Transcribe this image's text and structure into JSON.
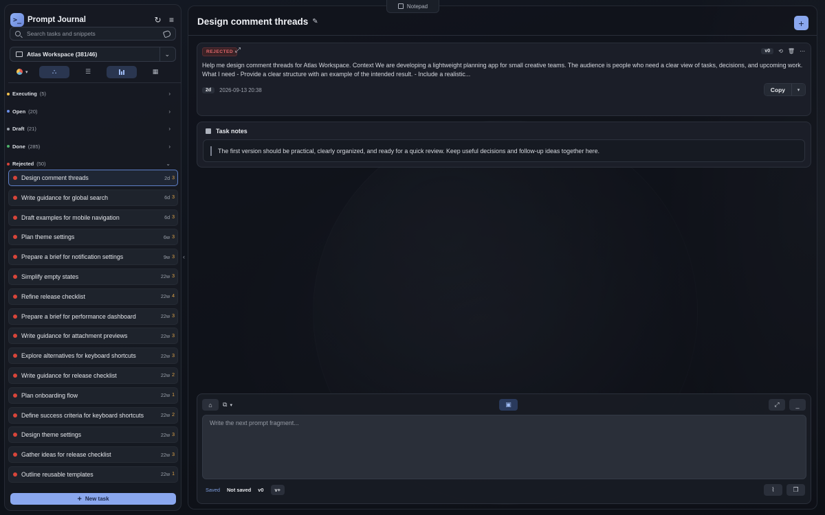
{
  "notepad": {
    "label": "Notepad"
  },
  "app": {
    "title": "Prompt Journal",
    "logo_glyph": ">_"
  },
  "search": {
    "placeholder": "Search tasks and snippets"
  },
  "workspace": {
    "label": "Atlas Workspace (381/46)"
  },
  "groups": [
    {
      "name": "Executing",
      "count": "(5)",
      "color": "#f2c14e",
      "expanded": false
    },
    {
      "name": "Open",
      "count": "(20)",
      "color": "#6b8fe8",
      "expanded": false
    },
    {
      "name": "Draft",
      "count": "(21)",
      "color": "#9aa0aa",
      "expanded": false
    },
    {
      "name": "Done",
      "count": "(285)",
      "color": "#4fb36b",
      "expanded": false
    },
    {
      "name": "Rejected",
      "count": "(50)",
      "color": "#d8453a",
      "expanded": true
    }
  ],
  "tasks": [
    {
      "title": "Design comment threads",
      "age": "2d",
      "count": "3"
    },
    {
      "title": "Write guidance for global search",
      "age": "6d",
      "count": "3"
    },
    {
      "title": "Draft examples for mobile navigation",
      "age": "6d",
      "count": "3"
    },
    {
      "title": "Plan theme settings",
      "age": "6w",
      "count": "3"
    },
    {
      "title": "Prepare a brief for notification settings",
      "age": "9w",
      "count": "3"
    },
    {
      "title": "Simplify empty states",
      "age": "22w",
      "count": "3"
    },
    {
      "title": "Refine release checklist",
      "age": "22w",
      "count": "4"
    },
    {
      "title": "Prepare a brief for performance dashboard",
      "age": "22w",
      "count": "3"
    },
    {
      "title": "Write guidance for attachment previews",
      "age": "22w",
      "count": "3"
    },
    {
      "title": "Explore alternatives for keyboard shortcuts",
      "age": "22w",
      "count": "3"
    },
    {
      "title": "Write guidance for release checklist",
      "age": "22w",
      "count": "2"
    },
    {
      "title": "Plan onboarding flow",
      "age": "22w",
      "count": "1"
    },
    {
      "title": "Define success criteria for keyboard shortcuts",
      "age": "22w",
      "count": "2"
    },
    {
      "title": "Design theme settings",
      "age": "22w",
      "count": "3"
    },
    {
      "title": "Gather ideas for release checklist",
      "age": "22w",
      "count": "3"
    },
    {
      "title": "Outline reusable templates",
      "age": "22w",
      "count": "1"
    }
  ],
  "new_task": {
    "label": "New task"
  },
  "main": {
    "title": "Design comment threads",
    "add_label": "+"
  },
  "prompt": {
    "status": "REJECTED",
    "version": "v0",
    "body": "Help me design comment threads for Atlas Workspace. Context We are developing a lightweight planning app for small creative teams. The audience is people who need a clear view of tasks, decisions, and upcoming work. What I need - Provide a clear structure with an example of the intended result. - Include a realistic...",
    "age": "2d",
    "timestamp": "2026-09-13 20:38",
    "copy_label": "Copy"
  },
  "notes": {
    "heading": "Task notes",
    "text": "The first version should be practical, clearly organized, and ready for a quick review. Keep useful decisions and follow-up ideas together here."
  },
  "composer": {
    "placeholder": "Write the next prompt fragment...",
    "saved": "Saved",
    "not_saved": "Not saved",
    "version": "v0",
    "version_add": "v+"
  },
  "colors": {
    "accent": "#8aa7ee",
    "rejected": "#d8453a",
    "count_orange": "#e2a64b"
  }
}
